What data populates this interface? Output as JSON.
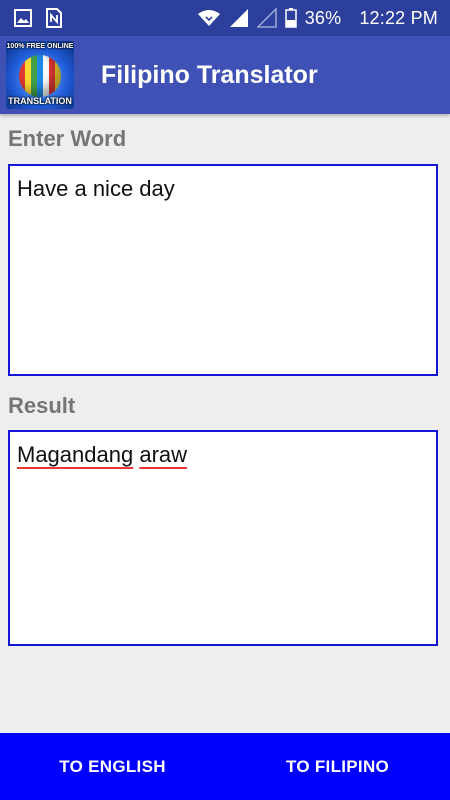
{
  "status_bar": {
    "icons": [
      "image-icon",
      "sim-icon",
      "wifi-icon",
      "signal-icon",
      "signal-empty-icon",
      "battery-icon"
    ],
    "battery": "36%",
    "time": "12:22 PM"
  },
  "app_bar": {
    "title": "Filipino Translator",
    "logo_top_text": "100% FREE ONLINE",
    "logo_bottom_text": "TRANSLATION"
  },
  "main": {
    "enter_label": "Enter Word",
    "input_text": "Have a nice day",
    "result_label": "Result",
    "result_words": [
      "Magandang",
      "araw"
    ]
  },
  "buttons": {
    "to_english": "TO ENGLISH",
    "to_filipino": "TO FILIPINO"
  },
  "colors": {
    "status_bar": "#2d3f9c",
    "app_bar": "#3f51b5",
    "box_border": "#1515d6",
    "button_bar": "#0000ff"
  }
}
